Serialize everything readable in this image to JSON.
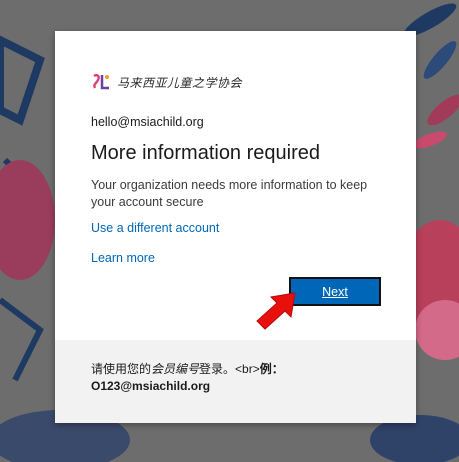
{
  "login": {
    "logo_text": "马来西亚儿童之学协会",
    "email": "hello@msiachild.org",
    "title": "More information required",
    "description": "Your organization needs more information to keep your account secure",
    "different_account_link": "Use a different account",
    "learn_more_link": "Learn more",
    "next_button": "Next"
  },
  "footer": {
    "part1": "请使用您的",
    "part2": "会员编号",
    "part3": "登录。<br>",
    "part4": "例：",
    "example": "O123@msiachild.org"
  },
  "colors": {
    "accent": "#0067b8",
    "arrow": "#e8100d",
    "footer_bg": "#f2f2f2"
  },
  "icons": {
    "logo": "organization-logo-icon",
    "arrow": "red-pointer-arrow-icon"
  }
}
